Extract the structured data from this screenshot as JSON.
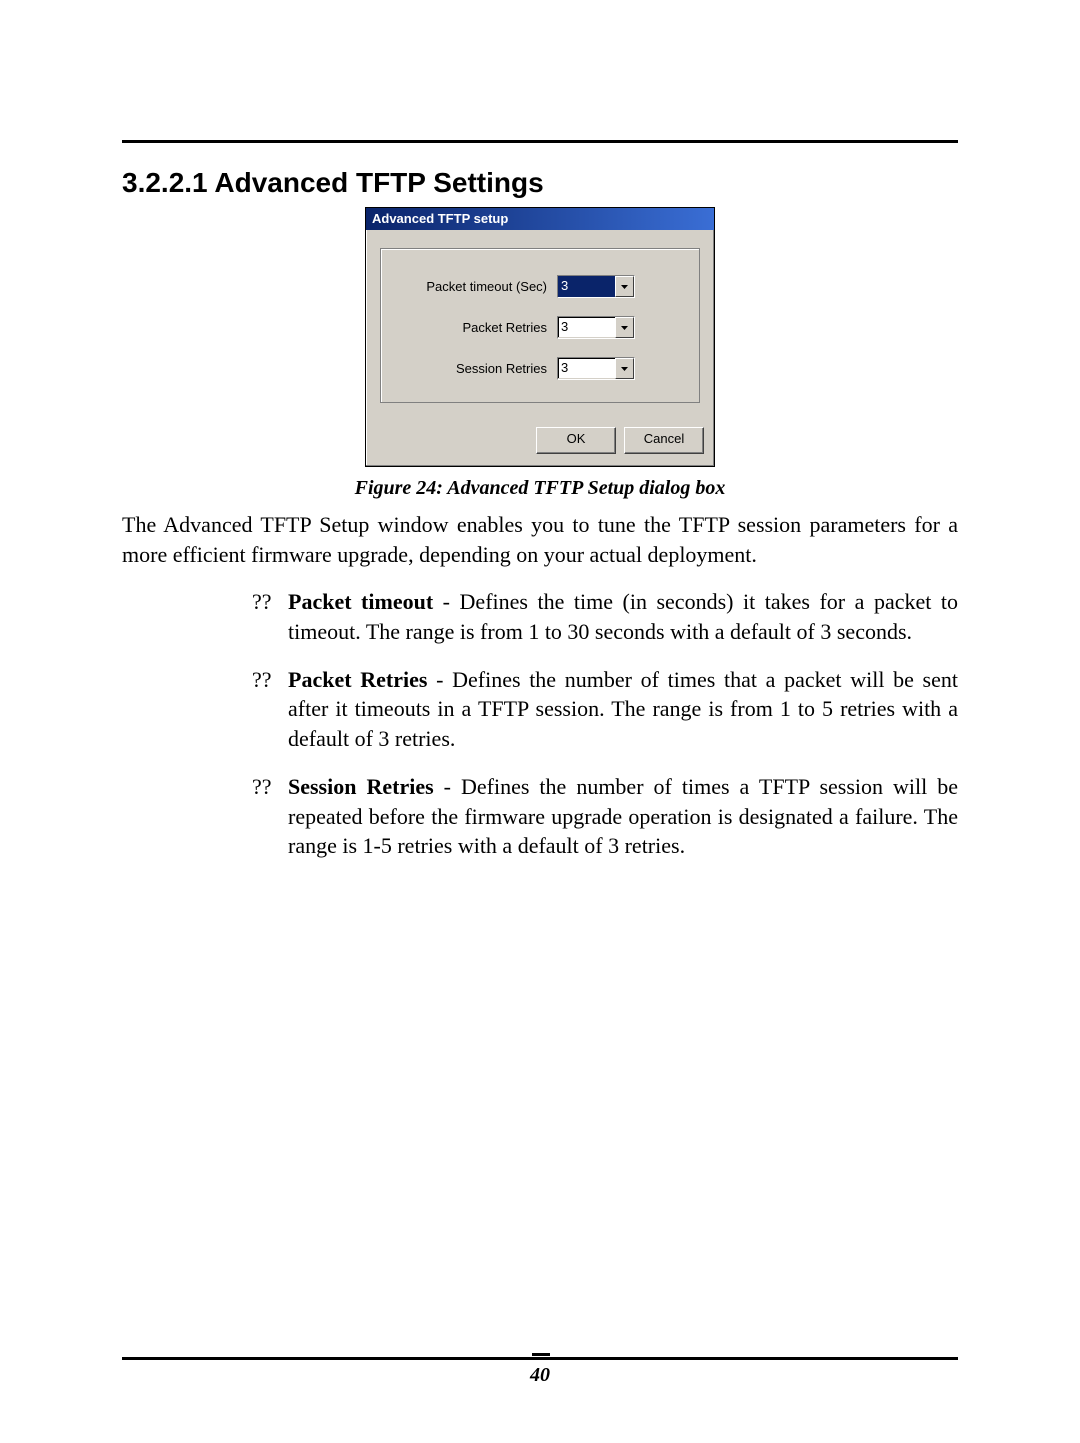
{
  "heading": "3.2.2.1  Advanced TFTP Settings",
  "dialog": {
    "title": "Advanced TFTP setup",
    "fields": {
      "packet_timeout": {
        "label": "Packet timeout (Sec)",
        "value": "3"
      },
      "packet_retries": {
        "label": "Packet Retries",
        "value": "3"
      },
      "session_retries": {
        "label": "Session Retries",
        "value": "3"
      }
    },
    "ok": "OK",
    "cancel": "Cancel"
  },
  "caption": "Figure 24: Advanced TFTP Setup dialog box",
  "intro": "The Advanced TFTP Setup window enables you to tune the TFTP session parameters for a more efficient firmware upgrade, depending on your actual deployment.",
  "bullets": {
    "marker": "??",
    "items": [
      {
        "term": "Packet timeout",
        "rest": " - Defines the time (in seconds) it takes for a packet to timeout. The range is from 1 to 30 seconds with a default of 3 seconds."
      },
      {
        "term": "Packet Retries",
        "rest": " - Defines the number of times that a packet will be sent after it timeouts in a TFTP session. The range is from 1 to 5 retries with a default of 3 retries."
      },
      {
        "term": "Session Retries",
        "rest": " - Defines the number of times a TFTP session will be repeated before the firmware upgrade operation is designated a failure. The range is 1-5 retries with a default of 3 retries."
      }
    ]
  },
  "page_number": "40"
}
